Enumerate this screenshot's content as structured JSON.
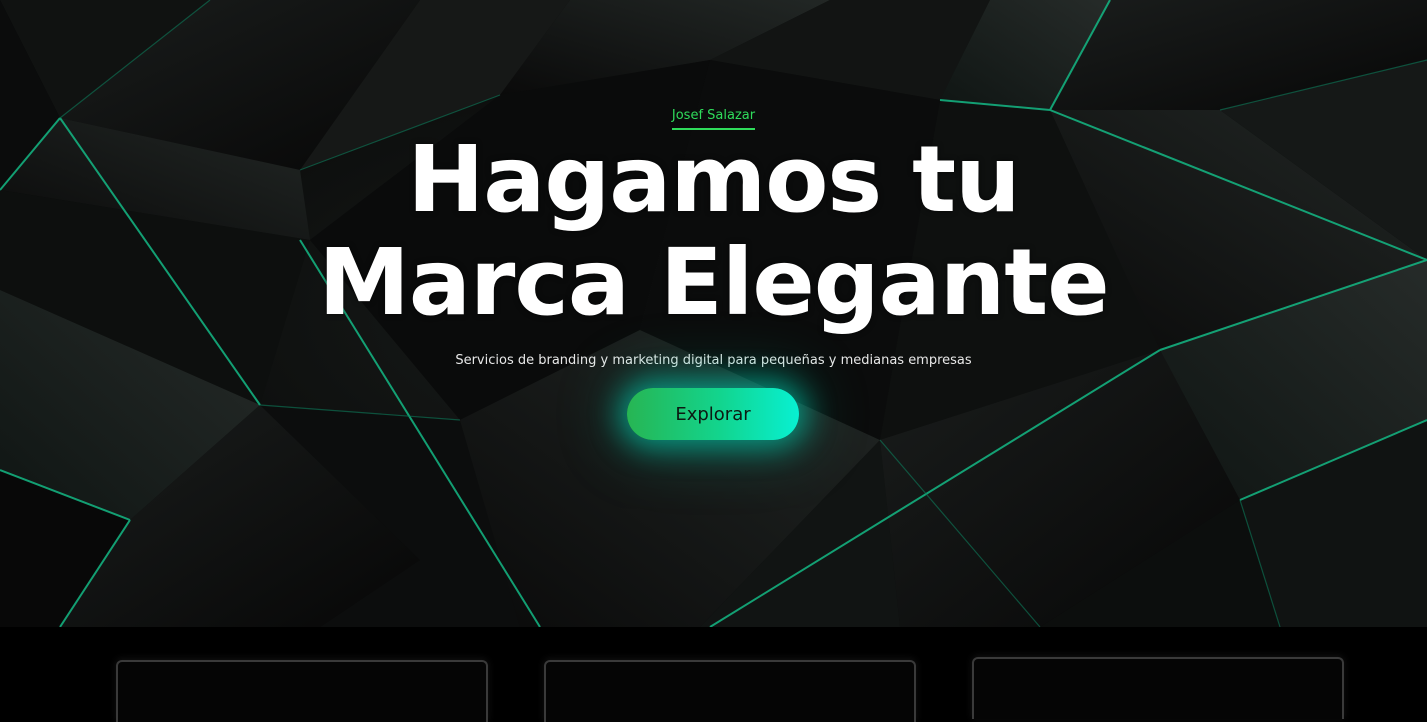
{
  "hero": {
    "eyebrow": "Josef Salazar",
    "headline_line1": "Hagamos tu",
    "headline_line2": "Marca Elegante",
    "subtitle": "Servicios de branding y marketing digital para pequeñas y medianas empresas",
    "cta_label": "Explorar",
    "background_icon": "polygon-pattern"
  },
  "colors": {
    "accent": "#2fdc5b",
    "cta_start": "#27b553",
    "cta_end": "#08f0d2",
    "edge_glow": "#14b985",
    "background": "#000000"
  },
  "cards": [
    {
      "name": "card-1"
    },
    {
      "name": "card-2"
    },
    {
      "name": "card-3"
    }
  ]
}
